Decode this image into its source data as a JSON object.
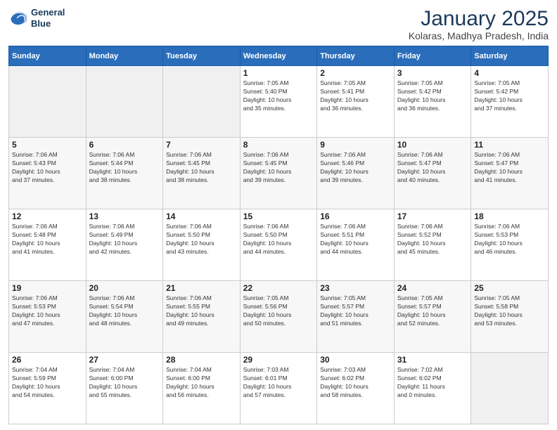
{
  "header": {
    "logo_line1": "General",
    "logo_line2": "Blue",
    "month": "January 2025",
    "location": "Kolaras, Madhya Pradesh, India"
  },
  "weekdays": [
    "Sunday",
    "Monday",
    "Tuesday",
    "Wednesday",
    "Thursday",
    "Friday",
    "Saturday"
  ],
  "weeks": [
    [
      {
        "day": "",
        "info": ""
      },
      {
        "day": "",
        "info": ""
      },
      {
        "day": "",
        "info": ""
      },
      {
        "day": "1",
        "info": "Sunrise: 7:05 AM\nSunset: 5:40 PM\nDaylight: 10 hours\nand 35 minutes."
      },
      {
        "day": "2",
        "info": "Sunrise: 7:05 AM\nSunset: 5:41 PM\nDaylight: 10 hours\nand 36 minutes."
      },
      {
        "day": "3",
        "info": "Sunrise: 7:05 AM\nSunset: 5:42 PM\nDaylight: 10 hours\nand 36 minutes."
      },
      {
        "day": "4",
        "info": "Sunrise: 7:05 AM\nSunset: 5:42 PM\nDaylight: 10 hours\nand 37 minutes."
      }
    ],
    [
      {
        "day": "5",
        "info": "Sunrise: 7:06 AM\nSunset: 5:43 PM\nDaylight: 10 hours\nand 37 minutes."
      },
      {
        "day": "6",
        "info": "Sunrise: 7:06 AM\nSunset: 5:44 PM\nDaylight: 10 hours\nand 38 minutes."
      },
      {
        "day": "7",
        "info": "Sunrise: 7:06 AM\nSunset: 5:45 PM\nDaylight: 10 hours\nand 38 minutes."
      },
      {
        "day": "8",
        "info": "Sunrise: 7:06 AM\nSunset: 5:45 PM\nDaylight: 10 hours\nand 39 minutes."
      },
      {
        "day": "9",
        "info": "Sunrise: 7:06 AM\nSunset: 5:46 PM\nDaylight: 10 hours\nand 39 minutes."
      },
      {
        "day": "10",
        "info": "Sunrise: 7:06 AM\nSunset: 5:47 PM\nDaylight: 10 hours\nand 40 minutes."
      },
      {
        "day": "11",
        "info": "Sunrise: 7:06 AM\nSunset: 5:47 PM\nDaylight: 10 hours\nand 41 minutes."
      }
    ],
    [
      {
        "day": "12",
        "info": "Sunrise: 7:06 AM\nSunset: 5:48 PM\nDaylight: 10 hours\nand 41 minutes."
      },
      {
        "day": "13",
        "info": "Sunrise: 7:06 AM\nSunset: 5:49 PM\nDaylight: 10 hours\nand 42 minutes."
      },
      {
        "day": "14",
        "info": "Sunrise: 7:06 AM\nSunset: 5:50 PM\nDaylight: 10 hours\nand 43 minutes."
      },
      {
        "day": "15",
        "info": "Sunrise: 7:06 AM\nSunset: 5:50 PM\nDaylight: 10 hours\nand 44 minutes."
      },
      {
        "day": "16",
        "info": "Sunrise: 7:06 AM\nSunset: 5:51 PM\nDaylight: 10 hours\nand 44 minutes."
      },
      {
        "day": "17",
        "info": "Sunrise: 7:06 AM\nSunset: 5:52 PM\nDaylight: 10 hours\nand 45 minutes."
      },
      {
        "day": "18",
        "info": "Sunrise: 7:06 AM\nSunset: 5:53 PM\nDaylight: 10 hours\nand 46 minutes."
      }
    ],
    [
      {
        "day": "19",
        "info": "Sunrise: 7:06 AM\nSunset: 5:53 PM\nDaylight: 10 hours\nand 47 minutes."
      },
      {
        "day": "20",
        "info": "Sunrise: 7:06 AM\nSunset: 5:54 PM\nDaylight: 10 hours\nand 48 minutes."
      },
      {
        "day": "21",
        "info": "Sunrise: 7:06 AM\nSunset: 5:55 PM\nDaylight: 10 hours\nand 49 minutes."
      },
      {
        "day": "22",
        "info": "Sunrise: 7:05 AM\nSunset: 5:56 PM\nDaylight: 10 hours\nand 50 minutes."
      },
      {
        "day": "23",
        "info": "Sunrise: 7:05 AM\nSunset: 5:57 PM\nDaylight: 10 hours\nand 51 minutes."
      },
      {
        "day": "24",
        "info": "Sunrise: 7:05 AM\nSunset: 5:57 PM\nDaylight: 10 hours\nand 52 minutes."
      },
      {
        "day": "25",
        "info": "Sunrise: 7:05 AM\nSunset: 5:58 PM\nDaylight: 10 hours\nand 53 minutes."
      }
    ],
    [
      {
        "day": "26",
        "info": "Sunrise: 7:04 AM\nSunset: 5:59 PM\nDaylight: 10 hours\nand 54 minutes."
      },
      {
        "day": "27",
        "info": "Sunrise: 7:04 AM\nSunset: 6:00 PM\nDaylight: 10 hours\nand 55 minutes."
      },
      {
        "day": "28",
        "info": "Sunrise: 7:04 AM\nSunset: 6:00 PM\nDaylight: 10 hours\nand 56 minutes."
      },
      {
        "day": "29",
        "info": "Sunrise: 7:03 AM\nSunset: 6:01 PM\nDaylight: 10 hours\nand 57 minutes."
      },
      {
        "day": "30",
        "info": "Sunrise: 7:03 AM\nSunset: 6:02 PM\nDaylight: 10 hours\nand 58 minutes."
      },
      {
        "day": "31",
        "info": "Sunrise: 7:02 AM\nSunset: 6:02 PM\nDaylight: 11 hours\nand 0 minutes."
      },
      {
        "day": "",
        "info": ""
      }
    ]
  ]
}
